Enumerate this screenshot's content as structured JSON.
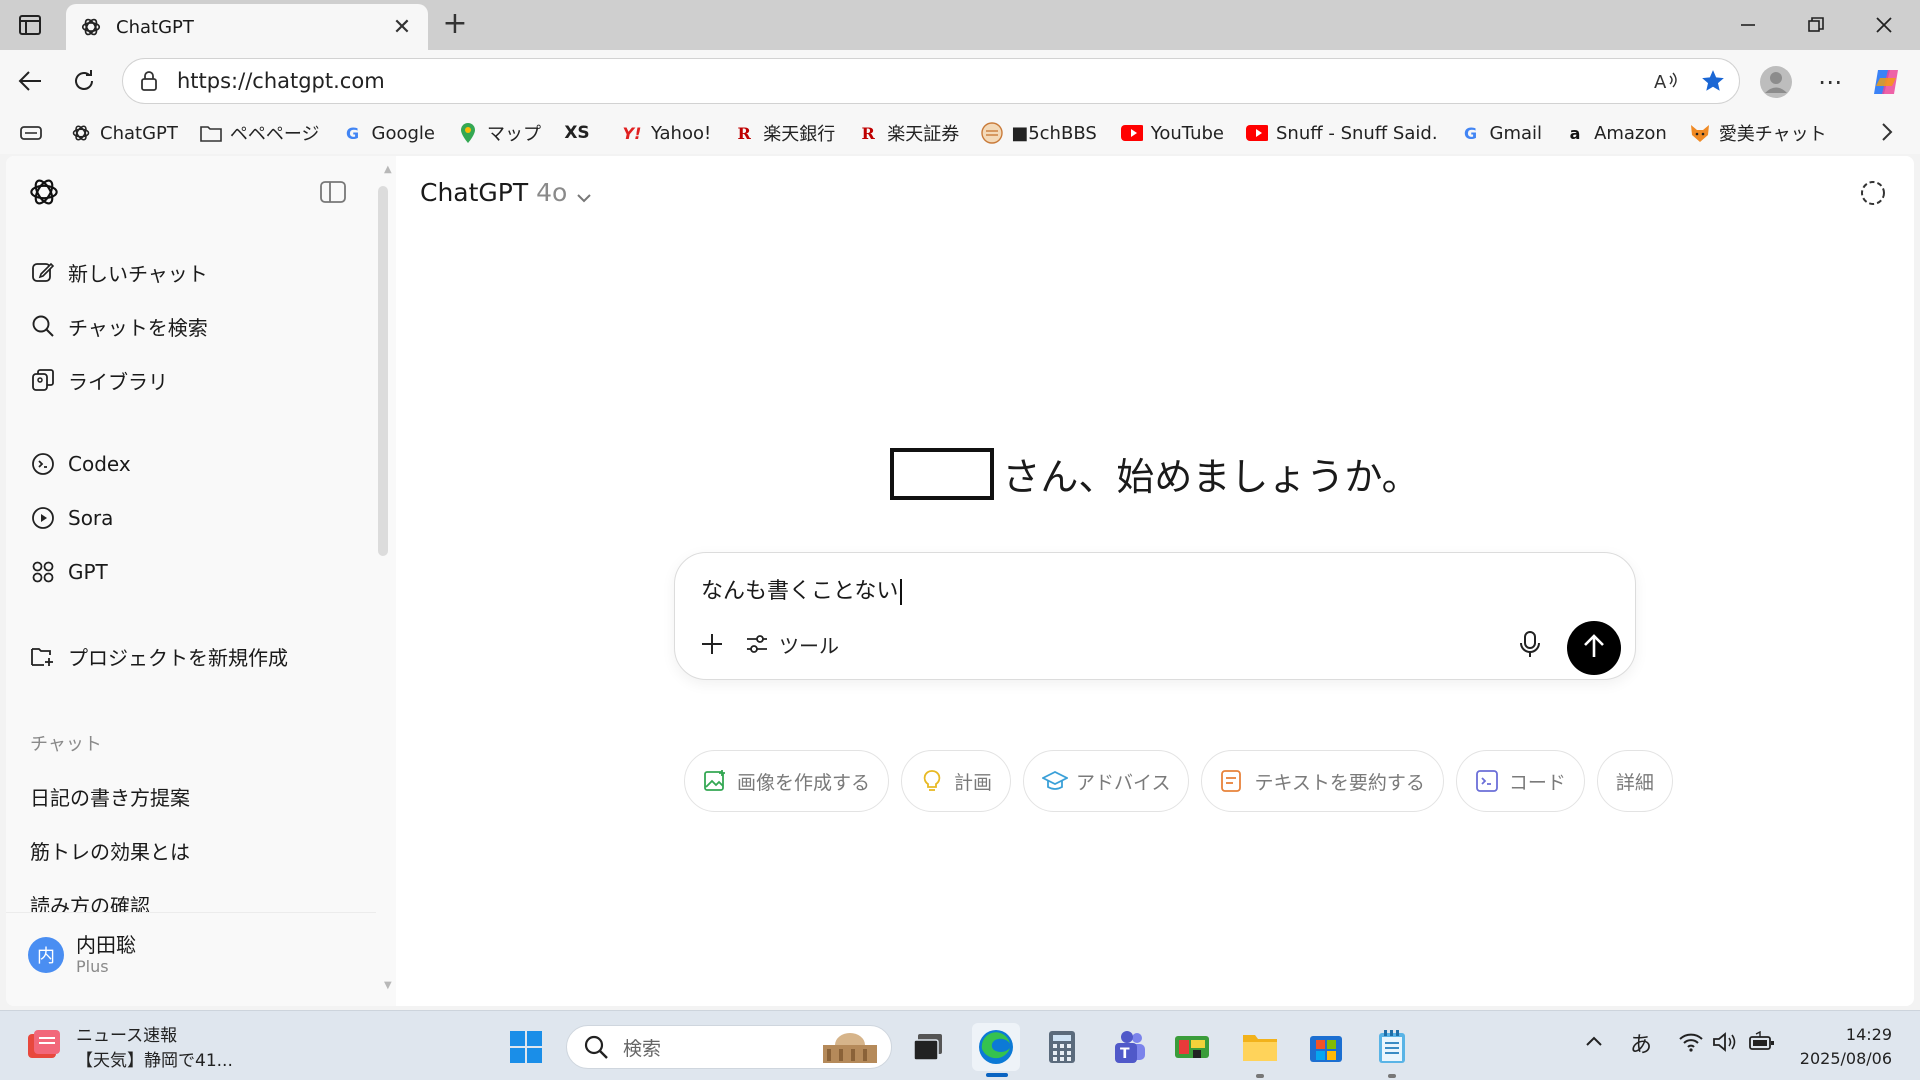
{
  "browser": {
    "tab_title": "ChatGPT",
    "tab_close": "✕",
    "new_tab": "+",
    "url": "https://chatgpt.com",
    "bookmarks": [
      {
        "label": "ChatGPT",
        "icon": "chatgpt-icon"
      },
      {
        "label": "ペペページ",
        "icon": "folder-icon"
      },
      {
        "label": "Google",
        "icon": "google-icon"
      },
      {
        "label": "マップ",
        "icon": "maps-pin-icon"
      },
      {
        "label": "",
        "icon": "xs-icon"
      },
      {
        "label": "Yahoo!",
        "icon": "yahoo-icon"
      },
      {
        "label": "楽天銀行",
        "icon": "rakuten-icon"
      },
      {
        "label": "楽天証券",
        "icon": "rakuten-icon"
      },
      {
        "label": "■5chBBS",
        "icon": "5ch-icon"
      },
      {
        "label": "YouTube",
        "icon": "youtube-icon"
      },
      {
        "label": "Snuff - Snuff Said.",
        "icon": "youtube-icon"
      },
      {
        "label": "Gmail",
        "icon": "google-icon"
      },
      {
        "label": "Amazon",
        "icon": "amazon-icon"
      },
      {
        "label": "愛美チャット",
        "icon": "fox-icon"
      }
    ],
    "xs_text": "XS"
  },
  "sidebar": {
    "items": [
      {
        "label": "新しいチャット",
        "icon": "new-chat-icon"
      },
      {
        "label": "チャットを検索",
        "icon": "search-icon"
      },
      {
        "label": "ライブラリ",
        "icon": "library-icon"
      },
      {
        "label": "Codex",
        "icon": "codex-icon"
      },
      {
        "label": "Sora",
        "icon": "sora-icon"
      },
      {
        "label": "GPT",
        "icon": "gpt-grid-icon"
      },
      {
        "label": "プロジェクトを新規作成",
        "icon": "new-project-icon"
      }
    ],
    "section_label": "チャット",
    "chats": [
      "日記の書き方提案",
      "筋トレの効果とは",
      "読み方の確認"
    ],
    "user": {
      "avatar_text": "内",
      "name": "内田聡",
      "plan": "Plus"
    }
  },
  "main": {
    "model": "ChatGPT",
    "model_version": "4o",
    "greeting_name": "",
    "greeting": "さん、始めましょうか。",
    "input_value": "なんも書くことない",
    "tools_label": "ツール",
    "chips": [
      {
        "label": "画像を作成する",
        "icon": "image-create-icon",
        "color": "#34a853"
      },
      {
        "label": "計画",
        "icon": "lightbulb-icon",
        "color": "#e8b923"
      },
      {
        "label": "アドバイス",
        "icon": "graduation-cap-icon",
        "color": "#3aa0d8"
      },
      {
        "label": "テキストを要約する",
        "icon": "document-icon",
        "color": "#e8823a"
      },
      {
        "label": "コード",
        "icon": "code-icon",
        "color": "#6b6fd8"
      },
      {
        "label": "詳細",
        "icon": "",
        "color": "#7a7a7a"
      }
    ]
  },
  "taskbar": {
    "news_title": "ニュース速報",
    "news_body": "【天気】静岡で41...",
    "search_placeholder": "検索",
    "ime": "あ",
    "time": "14:29",
    "date": "2025/08/06"
  },
  "colors": {
    "accent": "#0a64c2",
    "send_button": "#000000",
    "avatar": "#4a8ef2"
  }
}
